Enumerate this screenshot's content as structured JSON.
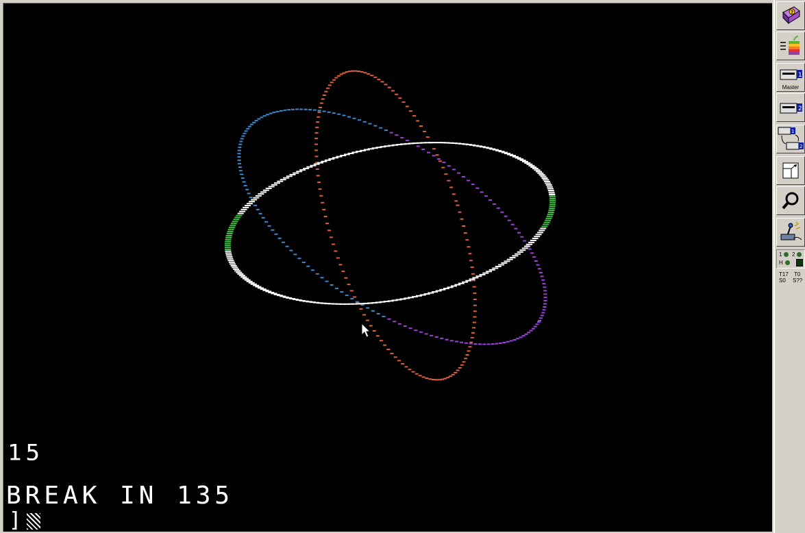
{
  "screen": {
    "lines": [
      "15",
      "BREAK IN 135"
    ],
    "prompt": "]",
    "background": "#000000",
    "text_color": "#ffffff"
  },
  "graphics": {
    "orbit_colors": {
      "white": "#ffffff",
      "orange": "#e0603a",
      "blue": "#3a8ad0",
      "purple": "#a040e0",
      "green": "#40c040"
    }
  },
  "toolbar": {
    "buttons": [
      {
        "name": "help",
        "icon": "help-book-icon",
        "label": ""
      },
      {
        "name": "run",
        "icon": "apple-logo-icon",
        "label": ""
      },
      {
        "name": "drive1",
        "icon": "disk-drive-1-icon",
        "label": "Master"
      },
      {
        "name": "drive2",
        "icon": "disk-drive-2-icon",
        "label": ""
      },
      {
        "name": "swap",
        "icon": "swap-drives-icon",
        "label": ""
      },
      {
        "name": "fullscreen",
        "icon": "fullscreen-icon",
        "label": ""
      },
      {
        "name": "debug",
        "icon": "magnifier-icon",
        "label": ""
      },
      {
        "name": "settings",
        "icon": "joystick-settings-icon",
        "label": ""
      }
    ],
    "drive_status": {
      "d1": "1",
      "d2": "2",
      "h": "H"
    },
    "track_info": {
      "t1": "T17",
      "t2": "T0",
      "s1": "S0",
      "s2": "S??"
    }
  }
}
